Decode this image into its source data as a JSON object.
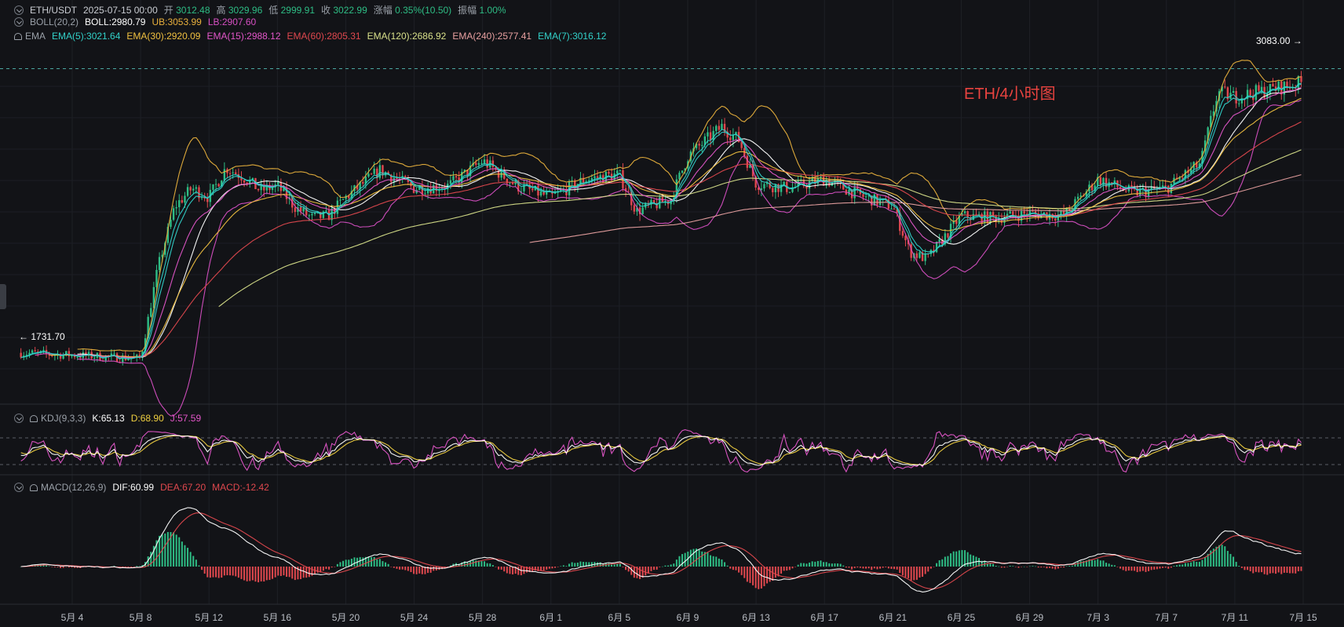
{
  "header": {
    "symbol": "ETH/USDT",
    "datetime": "2025-07-15 00:00",
    "open_label": "开",
    "open": "3012.48",
    "high_label": "高",
    "high": "3029.96",
    "low_label": "低",
    "low": "2999.91",
    "close_label": "收",
    "close": "3022.99",
    "change_label": "涨幅",
    "change": "0.35%(10.50)",
    "amp_label": "振幅",
    "amp": "1.00%"
  },
  "boll": {
    "name": "BOLL(20,2)",
    "mid": "BOLL:2980.79",
    "ub": "UB:3053.99",
    "lb": "LB:2907.60"
  },
  "ema": {
    "name": "EMA",
    "items": [
      "EMA(5):3021.64",
      "EMA(30):2920.09",
      "EMA(15):2988.12",
      "EMA(60):2805.31",
      "EMA(120):2686.92",
      "EMA(240):2577.41",
      "EMA(7):3016.12"
    ]
  },
  "kdj": {
    "name": "KDJ(9,3,3)",
    "k": "K:65.13",
    "d": "D:68.90",
    "j": "J:57.59"
  },
  "macd": {
    "name": "MACD(12,26,9)",
    "dif": "DIF:60.99",
    "dea": "DEA:67.20",
    "macd": "MACD:-12.42"
  },
  "annotations": {
    "title": "ETH/4小时图",
    "high_price": "3083.00",
    "low_price": "1731.70",
    "arrow_right": "→",
    "arrow_left": "←"
  },
  "colors": {
    "bg": "#121317",
    "up": "#2ebd85",
    "down": "#e0484e",
    "ema5": "#32d1c9",
    "ema7": "#32d1c9",
    "ema15": "#e356c9",
    "ema30": "#f0c040",
    "ema60": "#e0484e",
    "ema120": "#d8e08a",
    "ema240": "#e8a0a0",
    "boll_mid": "#ffffff",
    "boll_ub": "#e8b03c",
    "boll_lb": "#d64fc2",
    "kdj_k": "#ffffff",
    "kdj_d": "#f0d040",
    "kdj_j": "#e356c9",
    "dif": "#ffffff",
    "dea": "#e0484e",
    "annotation": "#e8433f"
  },
  "chart_data": {
    "type": "line",
    "subtype": "candlestick",
    "title": "ETH/4小时图",
    "x_ticks": [
      "5月 4",
      "5月 8",
      "5月 12",
      "5月 16",
      "5月 20",
      "5月 24",
      "5月 28",
      "6月 1",
      "6月 5",
      "6月 9",
      "6月 13",
      "6月 17",
      "6月 21",
      "6月 25",
      "6月 29",
      "7月 3",
      "7月 7",
      "7月 11",
      "7月 15"
    ],
    "price_ylim": [
      1650,
      3150
    ],
    "price_path": [
      [
        "5月 1",
        1840
      ],
      [
        "5月 4",
        1830
      ],
      [
        "5月 8",
        1815
      ],
      [
        "5月 9",
        2210
      ],
      [
        "5月 10",
        2480
      ],
      [
        "5月 11",
        2560
      ],
      [
        "5月 12",
        2520
      ],
      [
        "5月 13",
        2650
      ],
      [
        "5月 14",
        2610
      ],
      [
        "5月 15",
        2550
      ],
      [
        "5月 16",
        2570
      ],
      [
        "5月 17",
        2480
      ],
      [
        "5月 18",
        2430
      ],
      [
        "5月 19",
        2440
      ],
      [
        "5月 20",
        2520
      ],
      [
        "5月 21",
        2580
      ],
      [
        "5月 22",
        2640
      ],
      [
        "5月 24",
        2560
      ],
      [
        "5月 26",
        2570
      ],
      [
        "5月 28",
        2680
      ],
      [
        "5月 30",
        2570
      ],
      [
        "6月 1",
        2520
      ],
      [
        "6月 3",
        2600
      ],
      [
        "6月 5",
        2620
      ],
      [
        "6月 6",
        2460
      ],
      [
        "6月 8",
        2510
      ],
      [
        "6月 9",
        2700
      ],
      [
        "6月 11",
        2830
      ],
      [
        "6月 12",
        2770
      ],
      [
        "6月 13",
        2580
      ],
      [
        "6月 15",
        2560
      ],
      [
        "6月 17",
        2600
      ],
      [
        "6月 19",
        2530
      ],
      [
        "6月 21",
        2480
      ],
      [
        "6月 22",
        2280
      ],
      [
        "6月 23",
        2250
      ],
      [
        "6月 25",
        2440
      ],
      [
        "6月 27",
        2430
      ],
      [
        "6月 29",
        2450
      ],
      [
        "7月 1",
        2440
      ],
      [
        "7月 3",
        2600
      ],
      [
        "7月 5",
        2540
      ],
      [
        "7月 7",
        2560
      ],
      [
        "7月 9",
        2670
      ],
      [
        "7月 10",
        2980
      ],
      [
        "7月 11",
        2960
      ],
      [
        "7月 13",
        2990
      ],
      [
        "7月 15",
        3023
      ]
    ],
    "high_marker": {
      "x": "7月 14",
      "value": 3083.0
    },
    "low_marker": {
      "x": "5月 1",
      "value": 1731.7
    },
    "series": [
      {
        "name": "EMA(5)",
        "last": 3021.64
      },
      {
        "name": "EMA(7)",
        "last": 3016.12
      },
      {
        "name": "EMA(15)",
        "last": 2988.12
      },
      {
        "name": "EMA(30)",
        "last": 2920.09
      },
      {
        "name": "EMA(60)",
        "last": 2805.31
      },
      {
        "name": "EMA(120)",
        "last": 2686.92
      },
      {
        "name": "EMA(240)",
        "last": 2577.41
      },
      {
        "name": "BOLL",
        "last": 2980.79
      },
      {
        "name": "UB",
        "last": 3053.99
      },
      {
        "name": "LB",
        "last": 2907.6
      }
    ],
    "kdj_last": {
      "K": 65.13,
      "D": 68.9,
      "J": 57.59
    },
    "macd_last": {
      "DIF": 60.99,
      "DEA": 67.2,
      "MACD": -12.42
    },
    "grid": true
  }
}
